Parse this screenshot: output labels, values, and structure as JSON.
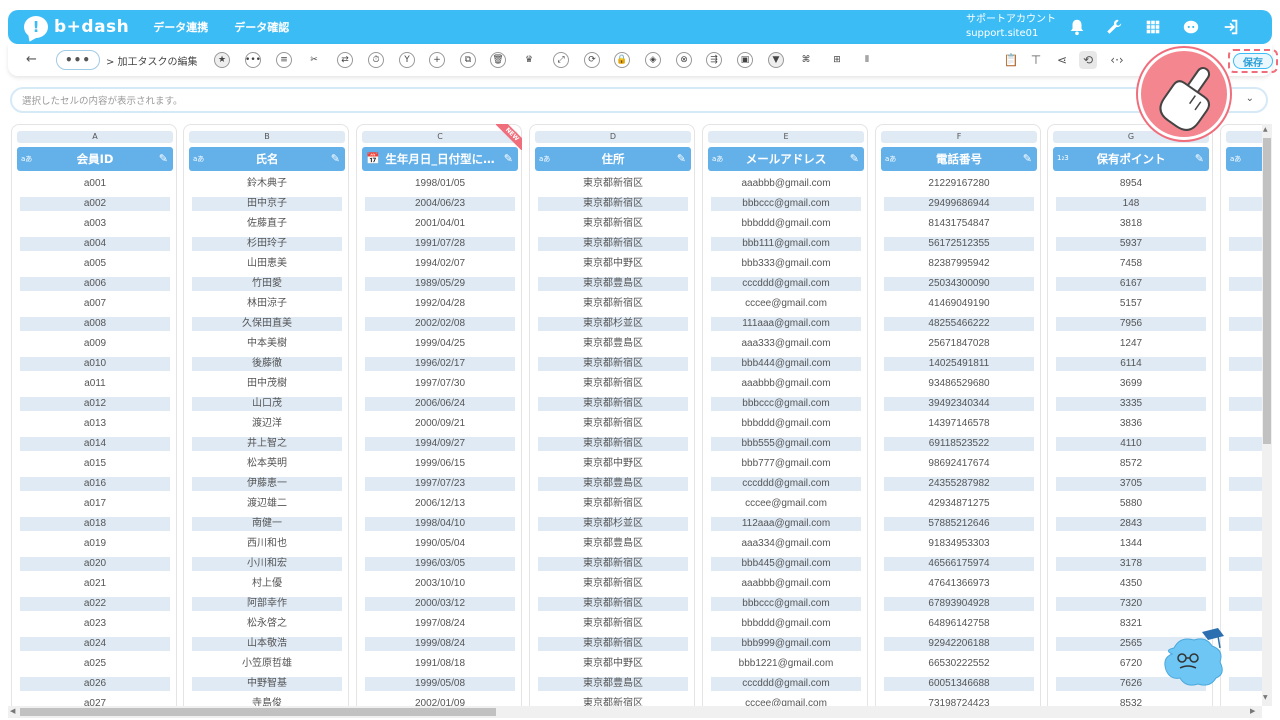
{
  "header": {
    "logo_text": "b+dash",
    "nav": [
      "データ連携",
      "データ確認"
    ],
    "account_name": "サポートアカウント",
    "account_id": "support.site01"
  },
  "toolbar": {
    "back": "←",
    "more": "•••",
    "breadcrumb": "> 加工タスクの編集",
    "save_label": "保存"
  },
  "cellbar": {
    "placeholder": "選択したセルの内容が表示されます。"
  },
  "columns": [
    {
      "letter": "A",
      "type": "aあ",
      "name": "会員ID"
    },
    {
      "letter": "B",
      "type": "aあ",
      "name": "氏名"
    },
    {
      "letter": "C",
      "type": "date",
      "name": "生年月日_日付型に…",
      "badge": "NEW"
    },
    {
      "letter": "D",
      "type": "aあ",
      "name": "住所"
    },
    {
      "letter": "E",
      "type": "aあ",
      "name": "メールアドレス"
    },
    {
      "letter": "F",
      "type": "aあ",
      "name": "電話番号"
    },
    {
      "letter": "G",
      "type": "1₂3",
      "name": "保有ポイント"
    },
    {
      "letter": "",
      "type": "aあ",
      "name": ""
    }
  ],
  "rows": [
    [
      "a001",
      "鈴木典子",
      "1998/01/05",
      "東京都新宿区",
      "aaabbb@gmail.com",
      "21229167280",
      "8954"
    ],
    [
      "a002",
      "田中京子",
      "2004/06/23",
      "東京都新宿区",
      "bbbccc@gmail.com",
      "29499686944",
      "148"
    ],
    [
      "a003",
      "佐藤直子",
      "2001/04/01",
      "東京都新宿区",
      "bbbddd@gmail.com",
      "81431754847",
      "3818"
    ],
    [
      "a004",
      "杉田玲子",
      "1991/07/28",
      "東京都新宿区",
      "bbb111@gmail.com",
      "56172512355",
      "5937"
    ],
    [
      "a005",
      "山田恵美",
      "1994/02/07",
      "東京都中野区",
      "bbb333@gmail.com",
      "82387995942",
      "7458"
    ],
    [
      "a006",
      "竹田愛",
      "1989/05/29",
      "東京都豊島区",
      "cccddd@gmail.com",
      "25034300090",
      "6167"
    ],
    [
      "a007",
      "林田涼子",
      "1992/04/28",
      "東京都新宿区",
      "cccee@gmail.com",
      "41469049190",
      "5157"
    ],
    [
      "a008",
      "久保田直美",
      "2002/02/08",
      "東京都杉並区",
      "111aaa@gmail.com",
      "48255466222",
      "7956"
    ],
    [
      "a009",
      "中本美樹",
      "1999/04/25",
      "東京都豊島区",
      "aaa333@gmail.com",
      "25671847028",
      "1247"
    ],
    [
      "a010",
      "後藤徹",
      "1996/02/17",
      "東京都新宿区",
      "bbb444@gmail.com",
      "14025491811",
      "6114"
    ],
    [
      "a011",
      "田中茂樹",
      "1997/07/30",
      "東京都新宿区",
      "aaabbb@gmail.com",
      "93486529680",
      "3699"
    ],
    [
      "a012",
      "山口茂",
      "2006/06/24",
      "東京都新宿区",
      "bbbccc@gmail.com",
      "39492340344",
      "3335"
    ],
    [
      "a013",
      "渡辺洋",
      "2000/09/21",
      "東京都新宿区",
      "bbbddd@gmail.com",
      "14397146578",
      "3836"
    ],
    [
      "a014",
      "井上智之",
      "1994/09/27",
      "東京都新宿区",
      "bbb555@gmail.com",
      "69118523522",
      "4110"
    ],
    [
      "a015",
      "松本英明",
      "1999/06/15",
      "東京都中野区",
      "bbb777@gmail.com",
      "98692417674",
      "8572"
    ],
    [
      "a016",
      "伊藤恵一",
      "1997/07/23",
      "東京都豊島区",
      "cccddd@gmail.com",
      "24355287982",
      "3705"
    ],
    [
      "a017",
      "渡辺雄二",
      "2006/12/13",
      "東京都新宿区",
      "cccee@gmail.com",
      "42934871275",
      "5880"
    ],
    [
      "a018",
      "南健一",
      "1998/04/10",
      "東京都杉並区",
      "112aaa@gmail.com",
      "57885212646",
      "2843"
    ],
    [
      "a019",
      "西川和也",
      "1990/05/04",
      "東京都豊島区",
      "aaa334@gmail.com",
      "91834953303",
      "1344"
    ],
    [
      "a020",
      "小川和宏",
      "1996/03/05",
      "東京都新宿区",
      "bbb445@gmail.com",
      "46566175974",
      "3178"
    ],
    [
      "a021",
      "村上優",
      "2003/10/10",
      "東京都新宿区",
      "aaabbb@gmail.com",
      "47641366973",
      "4350"
    ],
    [
      "a022",
      "阿部幸作",
      "2000/03/12",
      "東京都新宿区",
      "bbbccc@gmail.com",
      "67893904928",
      "7320"
    ],
    [
      "a023",
      "松永啓之",
      "1997/08/24",
      "東京都新宿区",
      "bbbddd@gmail.com",
      "64896142758",
      "8321"
    ],
    [
      "a024",
      "山本敬浩",
      "1999/08/24",
      "東京都新宿区",
      "bbb999@gmail.com",
      "92942206188",
      "2565"
    ],
    [
      "a025",
      "小笠原哲雄",
      "1991/08/18",
      "東京都中野区",
      "bbb1221@gmail.com",
      "66530222552",
      "6720"
    ],
    [
      "a026",
      "中野智基",
      "1999/05/08",
      "東京都豊島区",
      "cccddd@gmail.com",
      "60051346688",
      "7626"
    ],
    [
      "a027",
      "寺島俊",
      "2002/01/09",
      "東京都新宿区",
      "cccee@gmail.com",
      "73198724423",
      "8532"
    ]
  ]
}
